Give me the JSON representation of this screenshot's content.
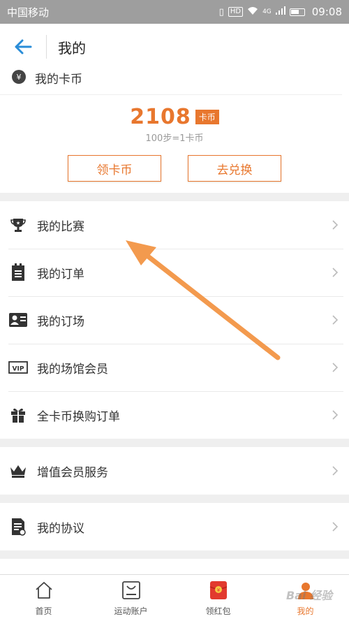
{
  "statusbar": {
    "carrier": "中国移动",
    "network": "4G",
    "hd": "HD",
    "time": "09:08"
  },
  "header": {
    "title": "我的"
  },
  "coin": {
    "section_label": "我的卡币",
    "value": "2108",
    "unit": "卡币",
    "rate": "100步=1卡币",
    "claim_label": "领卡币",
    "exchange_label": "去兑换",
    "accent_color": "#e8772e"
  },
  "menu_group1": [
    {
      "label": "我的比赛",
      "icon": "trophy-icon"
    },
    {
      "label": "我的订单",
      "icon": "order-clipboard-icon"
    },
    {
      "label": "我的订场",
      "icon": "venue-booking-icon"
    },
    {
      "label": "我的场馆会员",
      "icon": "vip-card-icon"
    },
    {
      "label": "全卡币换购订单",
      "icon": "gift-icon"
    }
  ],
  "menu_group2": [
    {
      "label": "增值会员服务",
      "icon": "crown-icon"
    }
  ],
  "menu_group3": [
    {
      "label": "我的协议",
      "icon": "agreement-doc-icon"
    }
  ],
  "tabbar": [
    {
      "label": "首页",
      "icon": "home-icon"
    },
    {
      "label": "运动账户",
      "icon": "sport-account-icon"
    },
    {
      "label": "领红包",
      "icon": "red-packet-icon"
    },
    {
      "label": "我的",
      "icon": "profile-icon",
      "active": true
    }
  ],
  "watermark": "Bai 经验"
}
